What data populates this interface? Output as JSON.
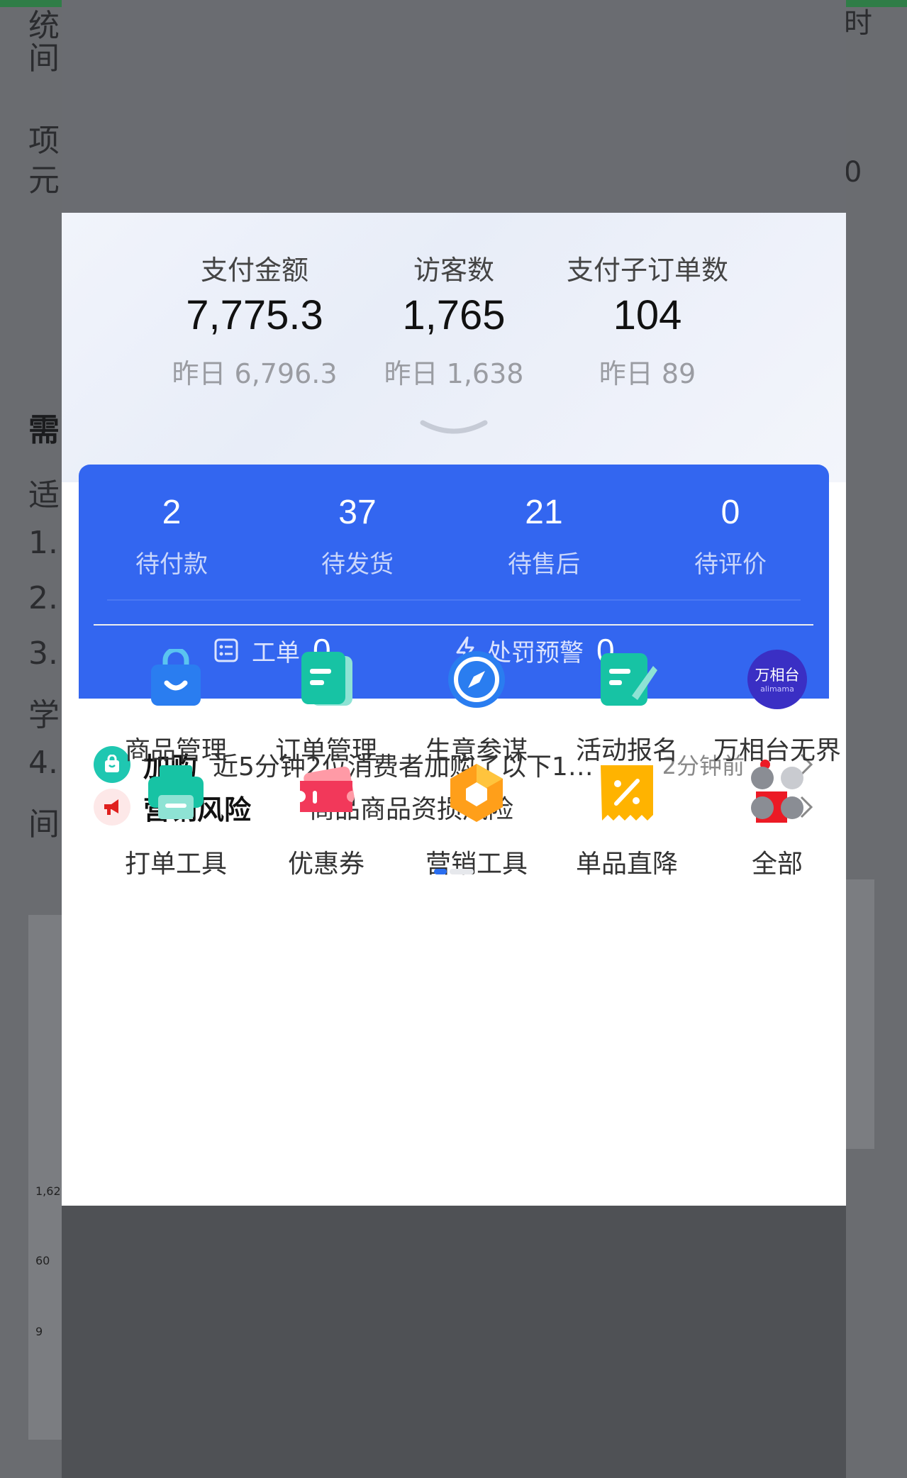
{
  "background": {
    "left_chars": [
      "统",
      "间",
      "项",
      "元",
      "需",
      "适",
      "1.",
      "2.",
      "3.",
      "学",
      "4.",
      "间"
    ],
    "right_chars": [
      "时",
      "0"
    ],
    "side_values": [
      "1,62",
      "60",
      "9"
    ]
  },
  "stats": [
    {
      "label": "支付金额",
      "value": "7,775.3",
      "prev": "昨日 6,796.3"
    },
    {
      "label": "访客数",
      "value": "1,765",
      "prev": "昨日 1,638"
    },
    {
      "label": "支付子订单数",
      "value": "104",
      "prev": "昨日 89"
    }
  ],
  "orders": [
    {
      "count": "2",
      "label": "待付款"
    },
    {
      "count": "37",
      "label": "待发货"
    },
    {
      "count": "21",
      "label": "待售后"
    },
    {
      "count": "0",
      "label": "待评价"
    }
  ],
  "workorder": {
    "label": "工单",
    "count": "0"
  },
  "penalty": {
    "label": "处罚预警",
    "count": "0"
  },
  "notices": {
    "addcart": {
      "title": "加购",
      "text": "近5分钟2位消费者加购了以下1…",
      "time": "2分钟前"
    },
    "risk": {
      "title": "营销风险",
      "text": "商品商品资损风险"
    }
  },
  "tools": [
    {
      "label": "商品管理",
      "icon": "shopping-bag-icon"
    },
    {
      "label": "订单管理",
      "icon": "order-doc-icon"
    },
    {
      "label": "生意参谋",
      "icon": "compass-icon"
    },
    {
      "label": "活动报名",
      "icon": "signup-icon"
    },
    {
      "label": "万相台无界",
      "icon": "alimama-logo-icon",
      "logo_text": "万相台",
      "logo_sub": "alimama"
    },
    {
      "label": "打单工具",
      "icon": "printer-icon"
    },
    {
      "label": "优惠券",
      "icon": "coupon-icon"
    },
    {
      "label": "营销工具",
      "icon": "hexagon-icon"
    },
    {
      "label": "单品直降",
      "icon": "discount-tag-icon"
    },
    {
      "label": "全部",
      "icon": "grid-dots-icon"
    }
  ],
  "colors": {
    "accent_blue": "#3366f0",
    "alert_red": "#ec1a25",
    "teal": "#1fc7b1"
  }
}
